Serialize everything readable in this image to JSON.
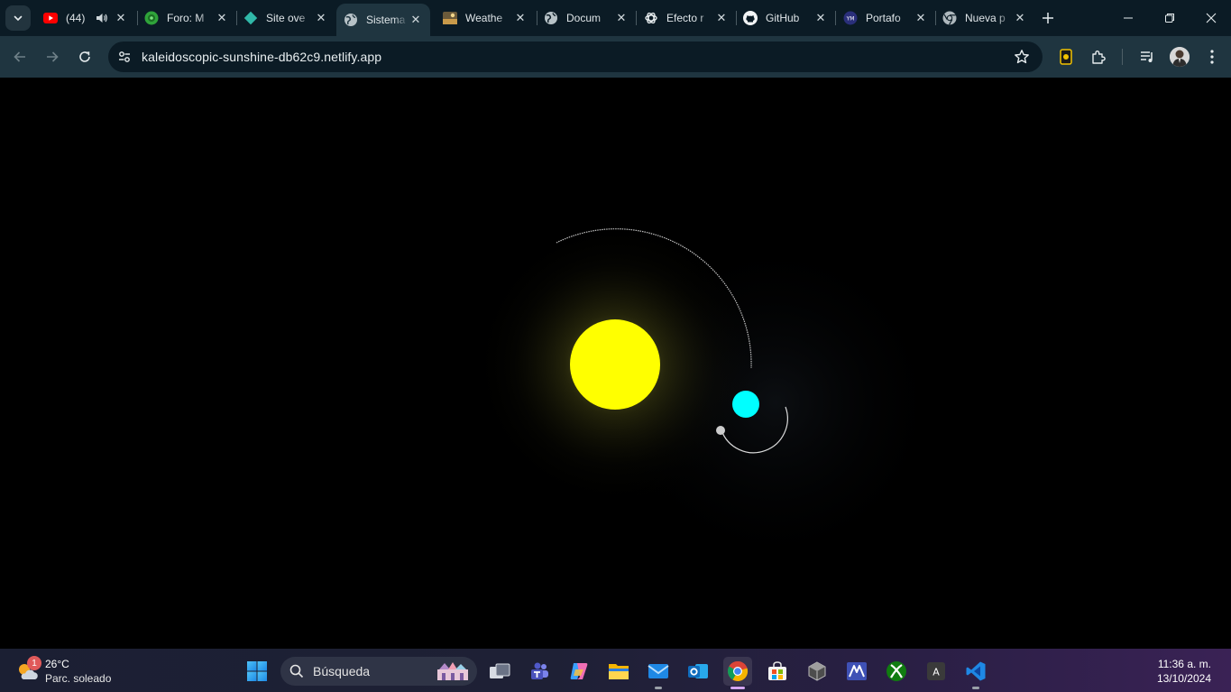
{
  "browser": {
    "tabs": [
      {
        "title": "(44)",
        "favicon": "youtube-icon",
        "audio": true,
        "active": false
      },
      {
        "title": "Foro: M",
        "favicon": "forum-icon",
        "active": false
      },
      {
        "title": "Site ove",
        "favicon": "netlify-icon",
        "active": false
      },
      {
        "title": "Sistema",
        "favicon": "globe-icon",
        "active": true
      },
      {
        "title": "Weathe",
        "favicon": "weather-thumb-icon",
        "active": false
      },
      {
        "title": "Docum",
        "favicon": "globe-icon",
        "active": false
      },
      {
        "title": "Efecto r",
        "favicon": "chatgpt-icon",
        "active": false
      },
      {
        "title": "GitHub",
        "favicon": "github-icon",
        "active": false
      },
      {
        "title": "Portafo",
        "favicon": "portfolio-icon",
        "active": false
      },
      {
        "title": "Nueva p",
        "favicon": "chrome-icon",
        "active": false
      }
    ],
    "address": "kaleidoscopic-sunshine-db62c9.netlify.app"
  },
  "scene": {
    "background": "#000000",
    "sun_color": "#ffff00",
    "planet_color": "#00ffff",
    "moon_color": "#cccccc",
    "orbit_color": "#ffffff"
  },
  "taskbar": {
    "weather": {
      "badge": "1",
      "temperature": "26°C",
      "description": "Parc. soleado"
    },
    "search_placeholder": "Búsqueda",
    "apps": [
      "task-view",
      "teams",
      "copilot",
      "file-explorer",
      "mail",
      "outlook",
      "chrome",
      "store",
      "cube-app",
      "ms-app",
      "xbox",
      "font-app",
      "vscode"
    ],
    "time": "11:36 a. m.",
    "date": "13/10/2024"
  }
}
